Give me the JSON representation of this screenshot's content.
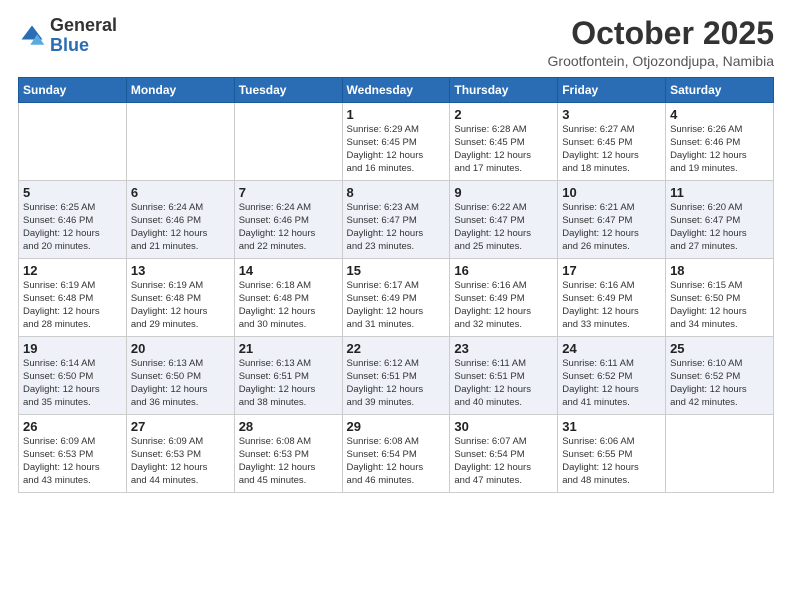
{
  "header": {
    "logo_general": "General",
    "logo_blue": "Blue",
    "title": "October 2025",
    "subtitle": "Grootfontein, Otjozondjupa, Namibia"
  },
  "weekdays": [
    "Sunday",
    "Monday",
    "Tuesday",
    "Wednesday",
    "Thursday",
    "Friday",
    "Saturday"
  ],
  "weeks": [
    [
      {
        "day": "",
        "info": ""
      },
      {
        "day": "",
        "info": ""
      },
      {
        "day": "",
        "info": ""
      },
      {
        "day": "1",
        "info": "Sunrise: 6:29 AM\nSunset: 6:45 PM\nDaylight: 12 hours\nand 16 minutes."
      },
      {
        "day": "2",
        "info": "Sunrise: 6:28 AM\nSunset: 6:45 PM\nDaylight: 12 hours\nand 17 minutes."
      },
      {
        "day": "3",
        "info": "Sunrise: 6:27 AM\nSunset: 6:45 PM\nDaylight: 12 hours\nand 18 minutes."
      },
      {
        "day": "4",
        "info": "Sunrise: 6:26 AM\nSunset: 6:46 PM\nDaylight: 12 hours\nand 19 minutes."
      }
    ],
    [
      {
        "day": "5",
        "info": "Sunrise: 6:25 AM\nSunset: 6:46 PM\nDaylight: 12 hours\nand 20 minutes."
      },
      {
        "day": "6",
        "info": "Sunrise: 6:24 AM\nSunset: 6:46 PM\nDaylight: 12 hours\nand 21 minutes."
      },
      {
        "day": "7",
        "info": "Sunrise: 6:24 AM\nSunset: 6:46 PM\nDaylight: 12 hours\nand 22 minutes."
      },
      {
        "day": "8",
        "info": "Sunrise: 6:23 AM\nSunset: 6:47 PM\nDaylight: 12 hours\nand 23 minutes."
      },
      {
        "day": "9",
        "info": "Sunrise: 6:22 AM\nSunset: 6:47 PM\nDaylight: 12 hours\nand 25 minutes."
      },
      {
        "day": "10",
        "info": "Sunrise: 6:21 AM\nSunset: 6:47 PM\nDaylight: 12 hours\nand 26 minutes."
      },
      {
        "day": "11",
        "info": "Sunrise: 6:20 AM\nSunset: 6:47 PM\nDaylight: 12 hours\nand 27 minutes."
      }
    ],
    [
      {
        "day": "12",
        "info": "Sunrise: 6:19 AM\nSunset: 6:48 PM\nDaylight: 12 hours\nand 28 minutes."
      },
      {
        "day": "13",
        "info": "Sunrise: 6:19 AM\nSunset: 6:48 PM\nDaylight: 12 hours\nand 29 minutes."
      },
      {
        "day": "14",
        "info": "Sunrise: 6:18 AM\nSunset: 6:48 PM\nDaylight: 12 hours\nand 30 minutes."
      },
      {
        "day": "15",
        "info": "Sunrise: 6:17 AM\nSunset: 6:49 PM\nDaylight: 12 hours\nand 31 minutes."
      },
      {
        "day": "16",
        "info": "Sunrise: 6:16 AM\nSunset: 6:49 PM\nDaylight: 12 hours\nand 32 minutes."
      },
      {
        "day": "17",
        "info": "Sunrise: 6:16 AM\nSunset: 6:49 PM\nDaylight: 12 hours\nand 33 minutes."
      },
      {
        "day": "18",
        "info": "Sunrise: 6:15 AM\nSunset: 6:50 PM\nDaylight: 12 hours\nand 34 minutes."
      }
    ],
    [
      {
        "day": "19",
        "info": "Sunrise: 6:14 AM\nSunset: 6:50 PM\nDaylight: 12 hours\nand 35 minutes."
      },
      {
        "day": "20",
        "info": "Sunrise: 6:13 AM\nSunset: 6:50 PM\nDaylight: 12 hours\nand 36 minutes."
      },
      {
        "day": "21",
        "info": "Sunrise: 6:13 AM\nSunset: 6:51 PM\nDaylight: 12 hours\nand 38 minutes."
      },
      {
        "day": "22",
        "info": "Sunrise: 6:12 AM\nSunset: 6:51 PM\nDaylight: 12 hours\nand 39 minutes."
      },
      {
        "day": "23",
        "info": "Sunrise: 6:11 AM\nSunset: 6:51 PM\nDaylight: 12 hours\nand 40 minutes."
      },
      {
        "day": "24",
        "info": "Sunrise: 6:11 AM\nSunset: 6:52 PM\nDaylight: 12 hours\nand 41 minutes."
      },
      {
        "day": "25",
        "info": "Sunrise: 6:10 AM\nSunset: 6:52 PM\nDaylight: 12 hours\nand 42 minutes."
      }
    ],
    [
      {
        "day": "26",
        "info": "Sunrise: 6:09 AM\nSunset: 6:53 PM\nDaylight: 12 hours\nand 43 minutes."
      },
      {
        "day": "27",
        "info": "Sunrise: 6:09 AM\nSunset: 6:53 PM\nDaylight: 12 hours\nand 44 minutes."
      },
      {
        "day": "28",
        "info": "Sunrise: 6:08 AM\nSunset: 6:53 PM\nDaylight: 12 hours\nand 45 minutes."
      },
      {
        "day": "29",
        "info": "Sunrise: 6:08 AM\nSunset: 6:54 PM\nDaylight: 12 hours\nand 46 minutes."
      },
      {
        "day": "30",
        "info": "Sunrise: 6:07 AM\nSunset: 6:54 PM\nDaylight: 12 hours\nand 47 minutes."
      },
      {
        "day": "31",
        "info": "Sunrise: 6:06 AM\nSunset: 6:55 PM\nDaylight: 12 hours\nand 48 minutes."
      },
      {
        "day": "",
        "info": ""
      }
    ]
  ]
}
